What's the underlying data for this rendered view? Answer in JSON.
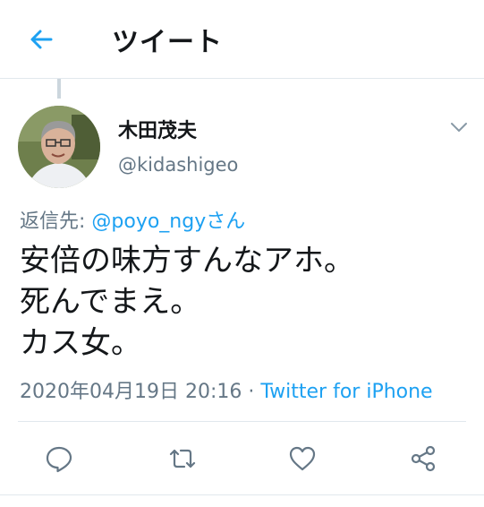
{
  "header": {
    "title": "ツイート"
  },
  "tweet": {
    "author_name": "木田茂夫",
    "author_handle": "@kidashigeo",
    "reply_prefix": "返信先: ",
    "reply_mention": "@poyo_ngyさん",
    "text_lines": [
      "安倍の味方すんなアホ。",
      "死んでまえ。",
      "カス女。"
    ],
    "timestamp": "2020年04月19日 20:16",
    "separator": " · ",
    "source": "Twitter for iPhone"
  },
  "icons": {
    "back": "arrow-left-icon",
    "caret": "chevron-down-icon",
    "reply": "reply-icon",
    "retweet": "retweet-icon",
    "like": "heart-icon",
    "share": "share-icon"
  },
  "colors": {
    "accent": "#1da1f2",
    "secondary_text": "#657786",
    "divider": "#e1e8ed",
    "primary_text": "#14171a"
  }
}
